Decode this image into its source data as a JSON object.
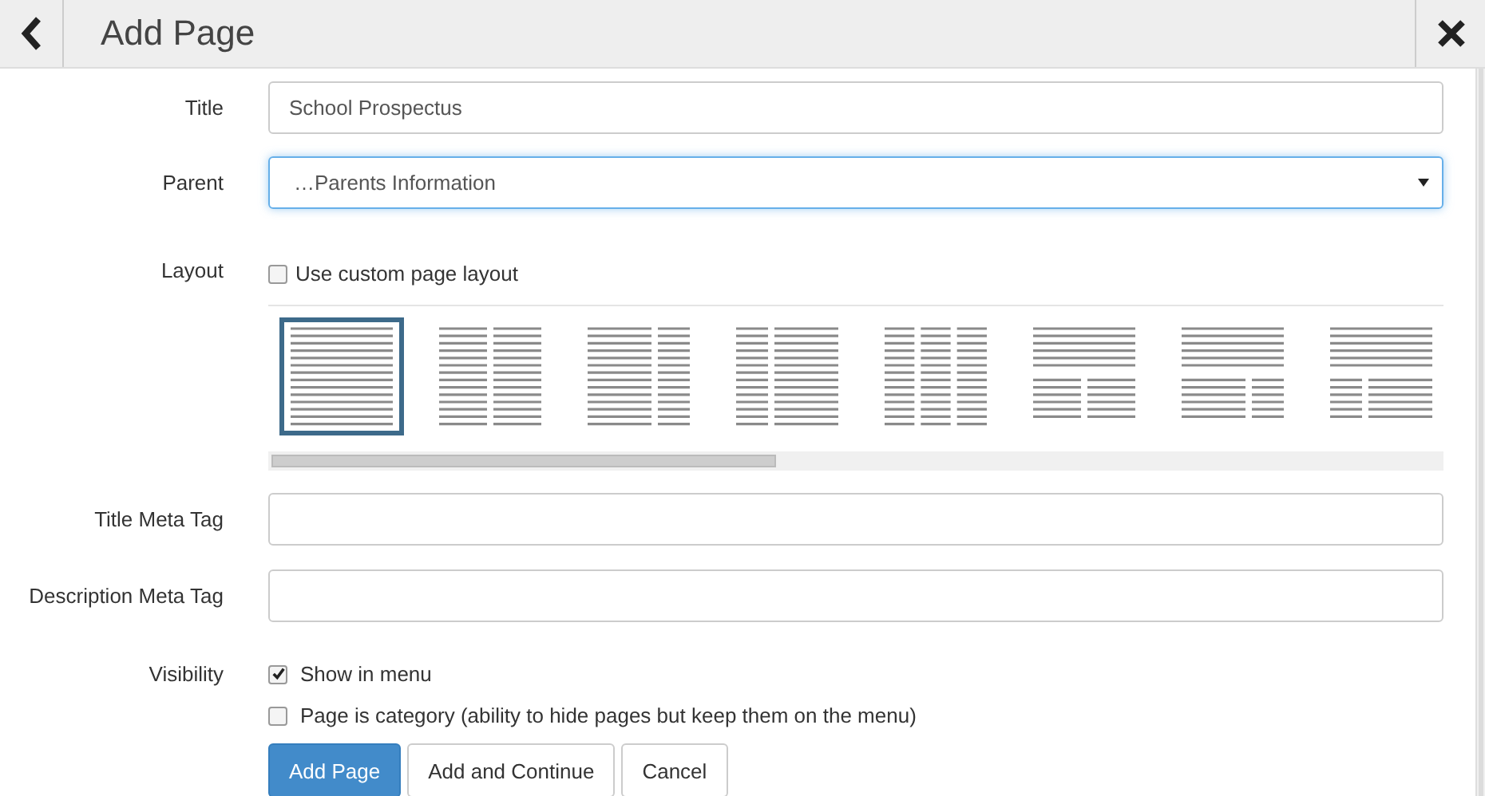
{
  "header": {
    "title": "Add Page"
  },
  "fields": [
    {
      "label": "Title",
      "kind": "text",
      "value": "School Prospectus",
      "focused": false
    },
    {
      "label": "Parent",
      "kind": "select",
      "value": "…Parents Information",
      "focused": true
    }
  ],
  "layout": {
    "label": "Layout",
    "custom_checkbox": {
      "label": "Use custom page layout",
      "checked": false
    },
    "options": [
      {
        "kind": "full",
        "selected": true
      },
      {
        "kind": "half-half",
        "selected": false
      },
      {
        "kind": "wide-narrow",
        "selected": false
      },
      {
        "kind": "narrow-wide",
        "selected": false
      },
      {
        "kind": "thirds",
        "selected": false
      },
      {
        "kind": "top-half-half",
        "selected": false
      },
      {
        "kind": "top-wide-narrow",
        "selected": false
      },
      {
        "kind": "top-narrow-wide",
        "selected": false
      }
    ]
  },
  "meta_fields": [
    {
      "label": "Title Meta Tag"
    },
    {
      "label": "Description Meta Tag"
    }
  ],
  "visibility": {
    "label": "Visibility",
    "options": [
      {
        "label": "Show in menu",
        "checked": true
      },
      {
        "label": "Page is category (ability to hide pages but keep them on the menu)",
        "checked": false
      }
    ]
  },
  "buttons": [
    {
      "label": "Add Page",
      "kind": "primary"
    },
    {
      "label": "Add and Continue",
      "kind": "default"
    },
    {
      "label": "Cancel",
      "kind": "default"
    }
  ]
}
